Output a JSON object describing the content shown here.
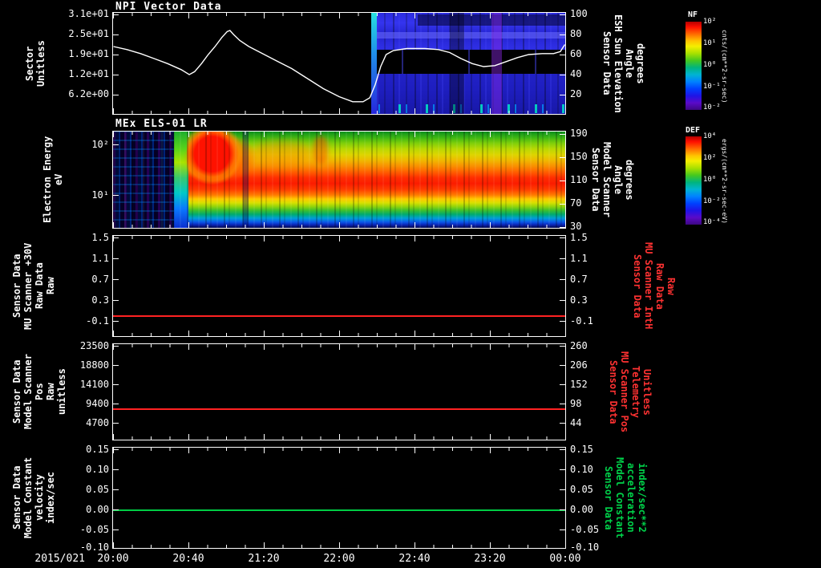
{
  "x_axis": {
    "date_label": "2015/021",
    "tick_labels": [
      "20:00",
      "20:40",
      "21:20",
      "22:00",
      "22:40",
      "23:20",
      "00:00"
    ]
  },
  "panels": [
    {
      "title": "NPI Vector Data",
      "left_label": "Sector\nUnitless",
      "left_ticks": [
        "3.1e+01",
        "2.5e+01",
        "1.9e+01",
        "1.2e+01",
        "6.2e+00"
      ],
      "right_label": "Sensor Data\nESH Sun Elevation\nAngle\ndegrees",
      "right_ticks": [
        "100",
        "80",
        "60",
        "40",
        "20"
      ]
    },
    {
      "title": "MEx ELS-01 LR",
      "left_label": "Electron Energy\neV",
      "left_ticks": [
        "10²",
        "10¹"
      ],
      "right_label": "Sensor Data\nModel Scanner\nAngle\ndegrees",
      "right_ticks": [
        "190",
        "150",
        "110",
        "70",
        "30"
      ]
    },
    {
      "left_label": "Sensor Data\nMU Scanner +30V\nRaw Data\nRaw",
      "left_ticks": [
        "1.5",
        "1.1",
        "0.7",
        "0.3",
        "-0.1"
      ],
      "right_label": "Sensor Data\nMU Scanner IntH\nRaw Data\nRaw",
      "right_ticks": [
        "1.5",
        "1.1",
        "0.7",
        "0.3",
        "-0.1"
      ],
      "line": {
        "color": "#ff2222",
        "value": 0.0
      }
    },
    {
      "left_label": "Sensor Data\nModel Scanner Pos\nRaw\nunitless",
      "left_ticks": [
        "23500",
        "18800",
        "14100",
        "9400",
        "4700"
      ],
      "right_label": "Sensor Data\nMU Scanner Pos\nTelemetry\nUnitless",
      "right_ticks": [
        "260",
        "206",
        "152",
        "98",
        "44"
      ],
      "line": {
        "color": "#ff2222",
        "value": 8200
      }
    },
    {
      "left_label": "Sensor Data\nModel Constant\nvelocity\nindex/sec",
      "left_ticks": [
        "0.15",
        "0.10",
        "0.05",
        "0.00",
        "-0.05",
        "-0.10"
      ],
      "right_label": "Sensor Data\nModel Constant\nacceleration\nindex/sec**2",
      "right_ticks": [
        "0.15",
        "0.10",
        "0.05",
        "0.00",
        "-0.05",
        "-0.10"
      ],
      "line": {
        "color": "#00cc44",
        "value": 0.0
      }
    }
  ],
  "colorbars": [
    {
      "title": "NF",
      "units": "cnts/(cm**2-sr-sec)",
      "ticks": [
        "10²",
        "10¹",
        "10⁰",
        "10⁻¹",
        "10⁻²"
      ]
    },
    {
      "title": "DEF",
      "units": "ergs/(cm**2-sr-sec-eV)",
      "ticks": [
        "10⁴",
        "10²",
        "10⁰",
        "10⁻²",
        "10⁻⁴"
      ]
    }
  ],
  "chart_data": [
    {
      "type": "line",
      "title": "NPI Vector Data",
      "series_name": "ESH Sun Elevation Angle",
      "x_start": "20:00",
      "x_end": "00:00",
      "x_tick_interval_min": 40,
      "y_left": {
        "label": "Sector Unitless",
        "ticks": [
          6.2,
          12,
          19,
          25,
          31
        ]
      },
      "y_right": {
        "label": "Sensor Data ESH Sun Elevation Angle degrees",
        "ticks": [
          20,
          40,
          60,
          80,
          100
        ]
      },
      "line_color": "#ffffff",
      "points_frac_value": [
        [
          0,
          68
        ],
        [
          0.03,
          65
        ],
        [
          0.06,
          61
        ],
        [
          0.09,
          56
        ],
        [
          0.12,
          51
        ],
        [
          0.15,
          45
        ],
        [
          0.168,
          40
        ],
        [
          0.18,
          43
        ],
        [
          0.195,
          51
        ],
        [
          0.21,
          60
        ],
        [
          0.225,
          68
        ],
        [
          0.24,
          77
        ],
        [
          0.252,
          83
        ],
        [
          0.258,
          84
        ],
        [
          0.266,
          80
        ],
        [
          0.28,
          74
        ],
        [
          0.3,
          68
        ],
        [
          0.33,
          61
        ],
        [
          0.36,
          54
        ],
        [
          0.395,
          46
        ],
        [
          0.43,
          36
        ],
        [
          0.465,
          26
        ],
        [
          0.5,
          18
        ],
        [
          0.53,
          13
        ],
        [
          0.553,
          13
        ],
        [
          0.568,
          17
        ],
        [
          0.58,
          30
        ],
        [
          0.592,
          48
        ],
        [
          0.604,
          60
        ],
        [
          0.62,
          64
        ],
        [
          0.65,
          66
        ],
        [
          0.69,
          66
        ],
        [
          0.72,
          65
        ],
        [
          0.745,
          62
        ],
        [
          0.77,
          56
        ],
        [
          0.795,
          51
        ],
        [
          0.82,
          48
        ],
        [
          0.845,
          49
        ],
        [
          0.87,
          53
        ],
        [
          0.895,
          57
        ],
        [
          0.92,
          60
        ],
        [
          0.95,
          61
        ],
        [
          0.975,
          61
        ],
        [
          0.99,
          63
        ],
        [
          1,
          70
        ]
      ]
    },
    {
      "type": "heatmap",
      "title": "NPI Vector Data spectrogram",
      "colorbar": "NF",
      "units": "cnts/(cm**2-sr-sec)",
      "x_extent_frac": [
        0.57,
        1.0
      ],
      "description": "blue/purple count spectrogram beginning ~22:15 with a black horizontal band through its middle, a bright cyan leading column, a purple column near 23:20 and cyan speckles along the bottom row"
    },
    {
      "type": "heatmap",
      "title": "MEx ELS-01 LR",
      "ylabel": "Electron Energy (eV)",
      "y_scale": "log",
      "y_ticks": [
        "10^1",
        "10^2"
      ],
      "colorbar": "DEF",
      "units": "ergs/(cm**2-sr-sec-eV)",
      "features": [
        "dark low-flux noisy region 20:00-20:25",
        "bright multicolour column ~20:27",
        "intense red burst 20:30-21:00 extending above ~20 eV to top of panel",
        "persistent red-orange band ~20-60 eV from 21:00 through 00:00",
        "yellow-green flux above the band, cyan-blue flux below ~8 eV",
        "orange patches near 21:10-21:40 at high energy"
      ]
    },
    {
      "type": "line",
      "title": "Sensor Data MU Scanner +30V Raw Data Raw",
      "constant_value": 0.0,
      "y_ticks": [
        -0.1,
        0.3,
        0.7,
        1.1,
        1.5
      ],
      "right_y_ticks": [
        -0.1,
        0.3,
        0.7,
        1.1,
        1.5
      ],
      "line_color": "#ff2222"
    },
    {
      "type": "line",
      "title": "Sensor Data Model Scanner Pos Raw unitless",
      "constant_value": 8200,
      "y_ticks": [
        4700,
        9400,
        14100,
        18800,
        23500
      ],
      "right_y_ticks": [
        44,
        98,
        152,
        206,
        260
      ],
      "line_color": "#ff2222"
    },
    {
      "type": "line",
      "title": "Sensor Data Model Constant velocity index/sec",
      "constant_value": 0.0,
      "y_ticks": [
        -0.1,
        -0.05,
        0.0,
        0.05,
        0.1,
        0.15
      ],
      "right_y_ticks": [
        -0.1,
        -0.05,
        0.0,
        0.05,
        0.1,
        0.15
      ],
      "line_color": "#00cc44"
    }
  ]
}
